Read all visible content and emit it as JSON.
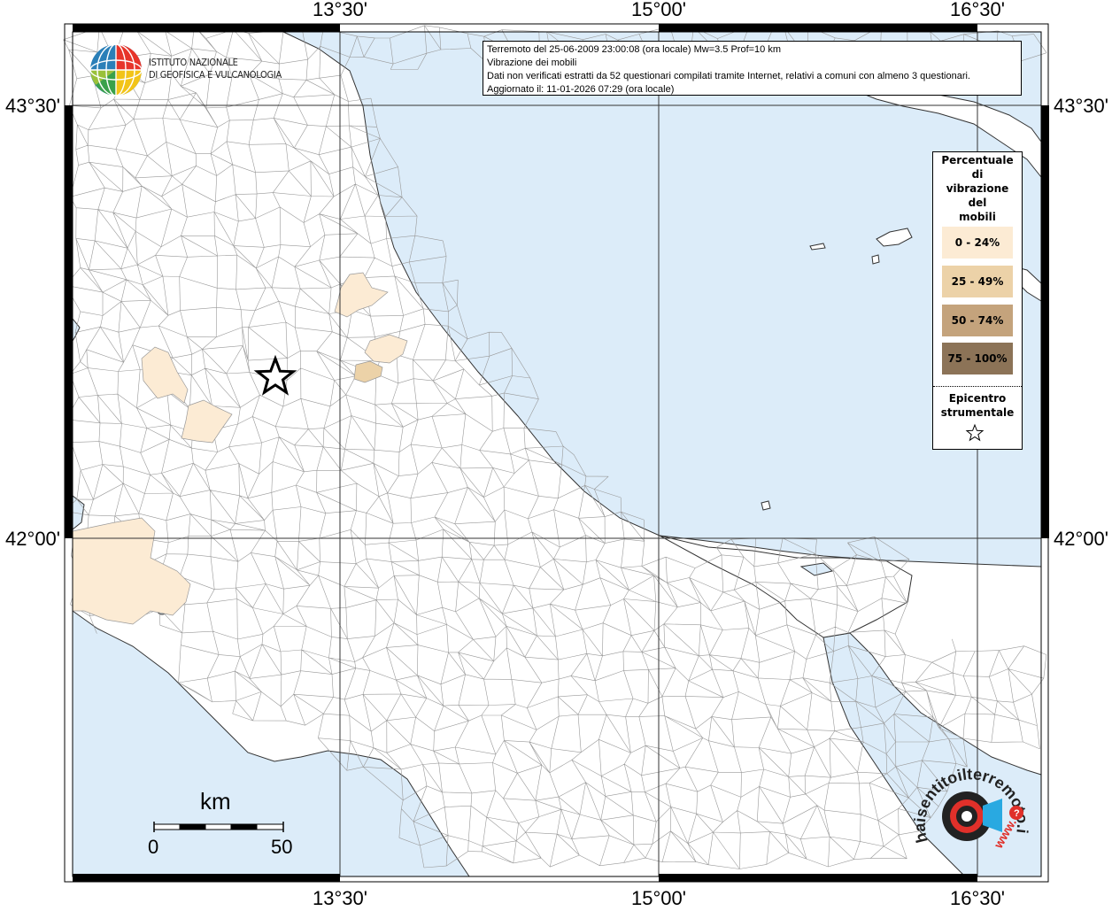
{
  "map": {
    "lon_labels": [
      "13°30'",
      "15°00'",
      "16°30'"
    ],
    "lat_labels": [
      "43°30'",
      "42°00'"
    ]
  },
  "info": {
    "line1": "Terremoto del 25-06-2009 23:00:08 (ora locale) Mw=3.5 Prof=10 km",
    "line2": "Vibrazione dei mobili",
    "line3": "Dati non verificati estratti da 52 questionari compilati tramite Internet, relativi a comuni con almeno 3 questionari.",
    "line4": "Aggiornato il: 11-01-2026 07:29 (ora locale)"
  },
  "logo": {
    "org_line1": "ISTITUTO NAZIONALE",
    "org_line2": "DI GEOFISICA E VULCANOLOGIA"
  },
  "legend": {
    "title": [
      "Percentuale",
      "di",
      "vibrazione",
      "del",
      "mobili"
    ],
    "classes": [
      {
        "label": "0 - 24%",
        "color": "#fcebd4"
      },
      {
        "label": "25 - 49%",
        "color": "#ecd2a8"
      },
      {
        "label": "50 - 74%",
        "color": "#c4a37c"
      },
      {
        "label": "75 - 100%",
        "color": "#8c7357"
      }
    ],
    "epicenter_title": [
      "Epicentro",
      "strumentale"
    ]
  },
  "scale_bar": {
    "unit": "km",
    "min_label": "0",
    "max_label": "50"
  },
  "watermark": {
    "text": "haisentitoilterremoto.it",
    "url_text": "www."
  },
  "colors": {
    "sea": "#dcecf9",
    "land": "#ffffff",
    "borders": "#999999"
  }
}
